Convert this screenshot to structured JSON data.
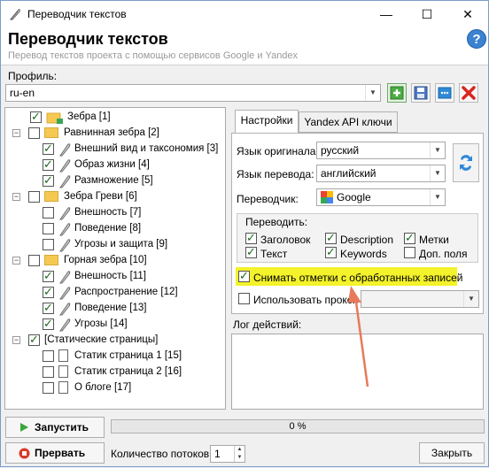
{
  "window": {
    "title": "Переводчик текстов",
    "min_label": "—",
    "max_label": "☐",
    "close_label": "✕"
  },
  "header": {
    "title": "Переводчик текстов",
    "subtitle": "Перевод текстов проекта с помощью сервисов Google и Yandex",
    "help_label": "?"
  },
  "profile": {
    "label": "Профиль:",
    "value": "ru-en"
  },
  "toolbar": {
    "add_label": "+",
    "save_label": "",
    "options_label": "",
    "delete_label": "✕"
  },
  "tree": {
    "expand_minus": "−",
    "nodes": [
      {
        "label": "Зебра [1]",
        "checked": true
      },
      {
        "label": "Равнинная зебра [2]",
        "checked": false
      },
      {
        "label": "Внешний вид и таксономия [3]",
        "checked": true
      },
      {
        "label": "Образ жизни [4]",
        "checked": true
      },
      {
        "label": "Размножение [5]",
        "checked": true
      },
      {
        "label": "Зебра Греви [6]",
        "checked": false
      },
      {
        "label": "Внешность [7]",
        "checked": false
      },
      {
        "label": "Поведение [8]",
        "checked": false
      },
      {
        "label": "Угрозы и защита [9]",
        "checked": false
      },
      {
        "label": "Горная зебра [10]",
        "checked": false
      },
      {
        "label": "Внешность [11]",
        "checked": true
      },
      {
        "label": "Распространение [12]",
        "checked": true
      },
      {
        "label": "Поведение [13]",
        "checked": true
      },
      {
        "label": "Угрозы [14]",
        "checked": true
      },
      {
        "label": "[Статические страницы]",
        "checked": true
      },
      {
        "label": "Статик страница 1 [15]",
        "checked": false
      },
      {
        "label": "Статик страница 2 [16]",
        "checked": false
      },
      {
        "label": "О блоге [17]",
        "checked": false
      }
    ]
  },
  "tabs": [
    {
      "label": "Настройки"
    },
    {
      "label": "Yandex API ключи"
    }
  ],
  "settings": {
    "source_label": "Язык оригинала:",
    "source_value": "русский",
    "target_label": "Язык перевода:",
    "target_value": "английский",
    "translator_label": "Переводчик:",
    "translator_value": "Google",
    "translate_group_label": "Переводить:",
    "translate_options": [
      {
        "label": "Заголовок",
        "checked": true
      },
      {
        "label": "Description",
        "checked": true
      },
      {
        "label": "Метки",
        "checked": true
      },
      {
        "label": "Текст",
        "checked": true
      },
      {
        "label": "Keywords",
        "checked": true
      },
      {
        "label": "Доп. поля",
        "checked": false
      }
    ],
    "clear_marks_label": "Снимать отметки с обработанных записей",
    "clear_marks_checked": true,
    "proxy_label": "Использовать прокси",
    "proxy_checked": false
  },
  "log": {
    "label": "Лог действий:"
  },
  "bottom": {
    "start_label": "Запустить",
    "stop_label": "Прервать",
    "progress_text": "0 %",
    "progress_value": 0,
    "threads_label": "Количество потоков:",
    "threads_value": "1",
    "close_label": "Закрыть"
  },
  "colors": {
    "highlight": "#f3f22b",
    "arrow": "#e8795a",
    "help": "#3b82d0"
  }
}
